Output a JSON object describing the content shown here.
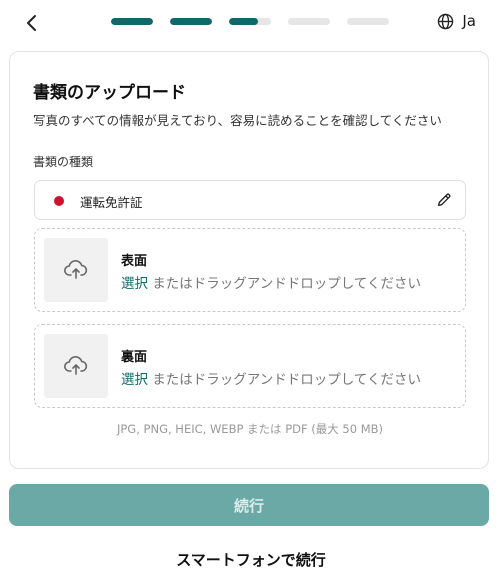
{
  "header": {
    "back_icon": "chevron-left-icon",
    "progress_fractions": [
      1,
      1,
      0.7,
      0,
      0
    ],
    "accent_color": "#11686a",
    "language_icon": "globe-icon",
    "language_label": "Ja"
  },
  "card": {
    "title": "書類のアップロード",
    "subtitle": "写真のすべての情報が見えており、容易に読めることを確認してください",
    "doc_type_label": "書類の種類",
    "doc_type_value": "運転免許証",
    "flag_color": "#d0112f",
    "edit_icon": "pencil-icon",
    "front": {
      "title": "表面",
      "select_link": "選択",
      "hint": " またはドラッグアンドドロップしてください",
      "icon": "upload-icon"
    },
    "back": {
      "title": "裏面",
      "select_link": "選択",
      "hint": " またはドラッグアンドドロップしてください",
      "icon": "upload-icon"
    },
    "formats": "JPG, PNG, HEIC, WEBP または PDF (最大 50 MB)"
  },
  "actions": {
    "continue_label": "続行",
    "phone_label": "スマートフォンで続行"
  }
}
